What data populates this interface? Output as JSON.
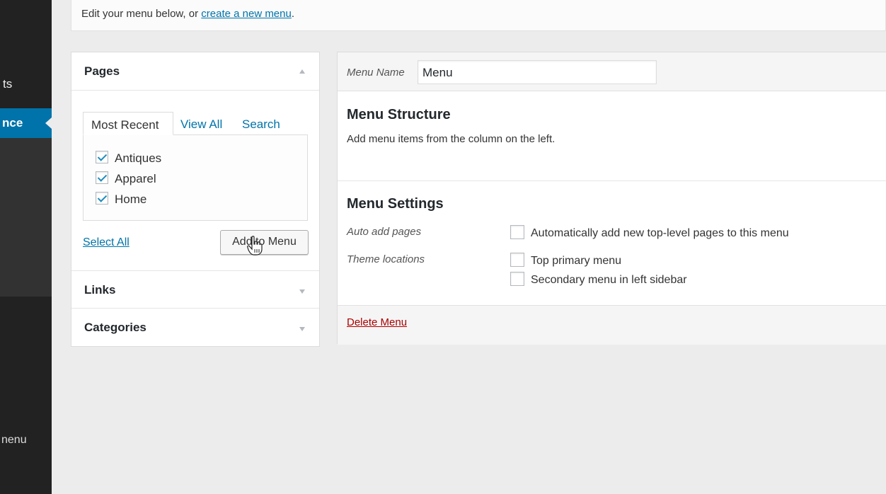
{
  "sidebar": {
    "item_partial_1": "ts",
    "active_item_partial": "nce",
    "item_partial_2": "nenu"
  },
  "notice": {
    "text": "Edit your menu below, or ",
    "link": "create a new menu",
    "suffix": "."
  },
  "accordion": {
    "pages_title": "Pages",
    "tabs": [
      "Most Recent",
      "View All",
      "Search"
    ],
    "pages": [
      {
        "label": "Antiques",
        "checked": true
      },
      {
        "label": "Apparel",
        "checked": true
      },
      {
        "label": "Home",
        "checked": true
      }
    ],
    "select_all": "Select All",
    "add_button": "Add to Menu",
    "links_title": "Links",
    "categories_title": "Categories"
  },
  "menu": {
    "name_label": "Menu Name",
    "name_value": "Menu",
    "structure_title": "Menu Structure",
    "structure_desc": "Add menu items from the column on the left.",
    "settings_title": "Menu Settings",
    "auto_add_label": "Auto add pages",
    "auto_add_option": "Automatically add new top-level pages to this menu",
    "theme_locations_label": "Theme locations",
    "locations": [
      "Top primary menu",
      "Secondary menu in left sidebar"
    ],
    "delete_link": "Delete Menu"
  },
  "colors": {
    "accent": "#0073aa",
    "sidebar": "#222222",
    "delete": "#aa0000"
  }
}
